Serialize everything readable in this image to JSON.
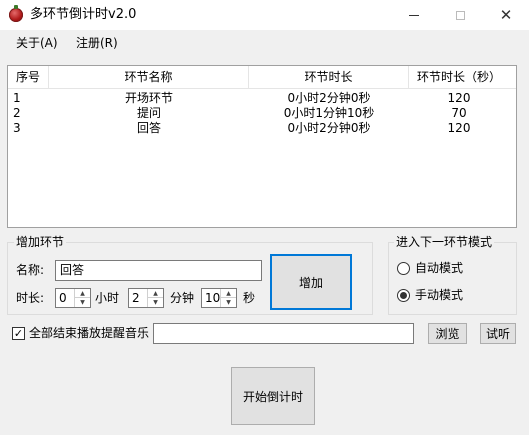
{
  "window": {
    "title": "多环节倒计时v2.0",
    "minimize_glyph": "",
    "maximize_glyph": "",
    "close_glyph": "✕"
  },
  "menu": {
    "about": "关于(A)",
    "register": "注册(R)"
  },
  "list": {
    "headers": [
      "序号",
      "环节名称",
      "环节时长",
      "环节时长（秒）"
    ],
    "rows": [
      [
        "1",
        "开场环节",
        "0小时2分钟0秒",
        "120"
      ],
      [
        "2",
        "提问",
        "0小时1分钟10秒",
        "70"
      ],
      [
        "3",
        "回答",
        "0小时2分钟0秒",
        "120"
      ]
    ]
  },
  "add_group": {
    "title": "增加环节",
    "name_label": "名称:",
    "name_value": "回答",
    "duration_label": "时长:",
    "hours_value": "0",
    "hours_unit": "小时",
    "minutes_value": "2",
    "minutes_unit": "分钟",
    "seconds_value": "10",
    "seconds_unit": "秒",
    "add_button": "增加"
  },
  "mode_group": {
    "title": "进入下一环节模式",
    "auto_label": "自动模式",
    "manual_label": "手动模式",
    "selected": "manual"
  },
  "music": {
    "checkbox_label": "全部结束播放提醒音乐",
    "checked": true,
    "check_glyph": "✓",
    "path_value": "",
    "browse_button": "浏览",
    "test_button": "试听"
  },
  "start_button": "开始倒计时",
  "icons": {
    "app": "app-tomato-icon",
    "spin_up": "▲",
    "spin_down": "▼"
  }
}
